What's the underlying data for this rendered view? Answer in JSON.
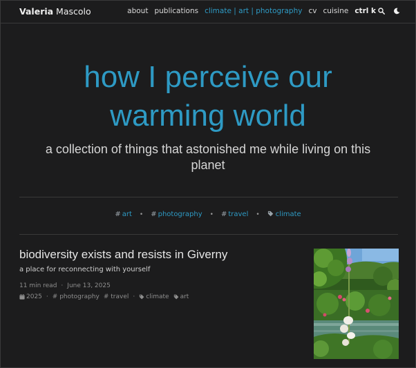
{
  "nav": {
    "brand_first": "Valeria",
    "brand_last": " Mascolo",
    "items": [
      {
        "label": "about",
        "active": false
      },
      {
        "label": "publications",
        "active": false
      },
      {
        "label": "climate | art | photography",
        "active": true
      },
      {
        "label": "cv",
        "active": false
      },
      {
        "label": "cuisine",
        "active": false
      }
    ],
    "search_label": "ctrl k",
    "search_icon": "search-icon",
    "theme_icon": "moon-icon"
  },
  "hero": {
    "title_line1": "how I perceive our",
    "title_line2": "warming world",
    "subtitle": "a collection of things that astonished me while living on this planet"
  },
  "tags": [
    {
      "label": "art",
      "icon": "hash"
    },
    {
      "label": "photography",
      "icon": "hash"
    },
    {
      "label": "travel",
      "icon": "hash"
    },
    {
      "label": "climate",
      "icon": "tag"
    }
  ],
  "post": {
    "title": "biodiversity exists and resists in Giverny",
    "description": "a place for reconnecting with yourself",
    "read_time": "11 min read",
    "date": "June 13, 2025",
    "year": "2025",
    "tags": [
      {
        "label": "photography",
        "icon": "hash"
      },
      {
        "label": "travel",
        "icon": "hash"
      },
      {
        "label": "climate",
        "icon": "tag"
      },
      {
        "label": "art",
        "icon": "tag"
      }
    ]
  },
  "colors": {
    "accent": "#2e9ac4",
    "background": "#1c1c1d",
    "divider": "#3a3a3a"
  }
}
